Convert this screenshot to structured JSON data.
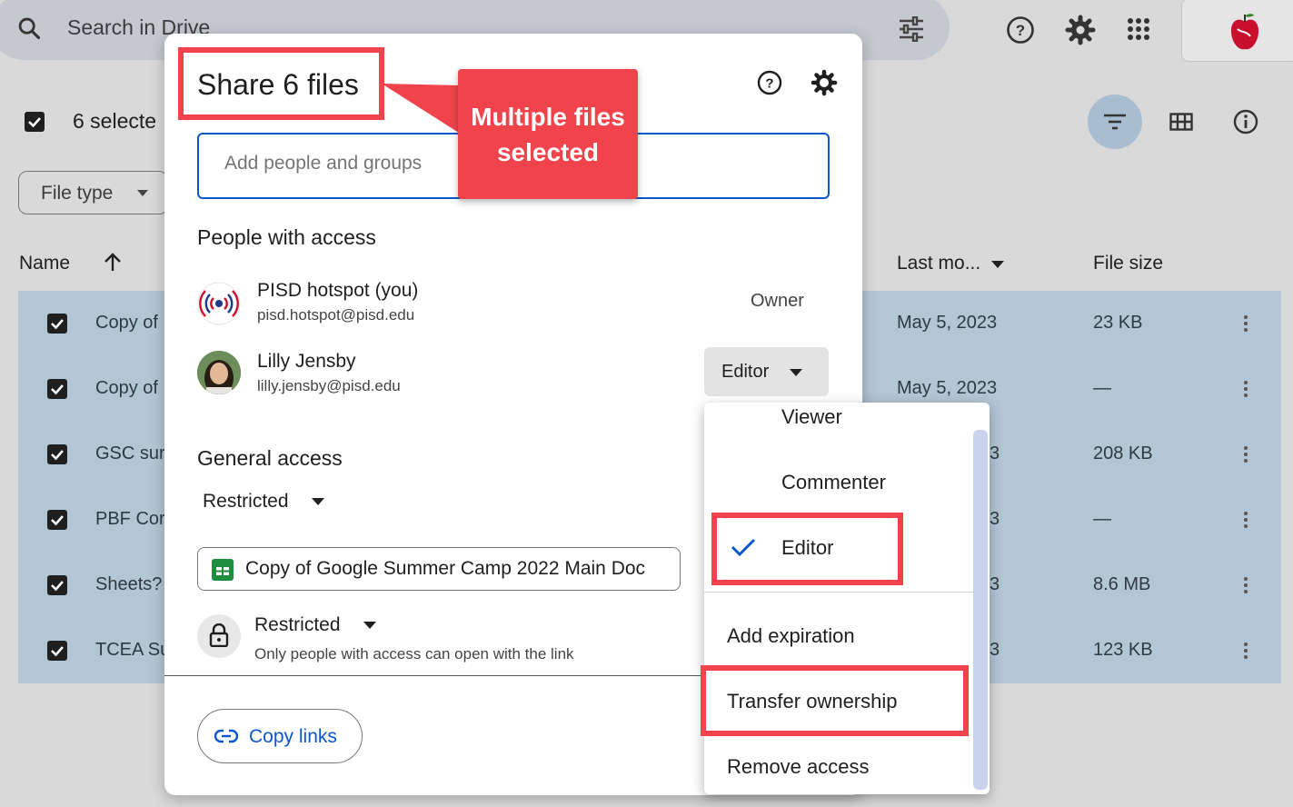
{
  "drive": {
    "search_placeholder": "Search in Drive",
    "selection_text": "6 selecte",
    "filter_chip": "File type",
    "columns": {
      "name": "Name",
      "last_modified": "Last mo...",
      "file_size": "File size"
    },
    "rows": [
      {
        "name": "Copy of",
        "date": "May 5, 2023",
        "size": "23 KB"
      },
      {
        "name": "Copy of",
        "date": "May 5, 2023",
        "size": "—"
      },
      {
        "name": "GSC sur",
        "date": "3",
        "size": "208 KB"
      },
      {
        "name": "PBF Cor",
        "date": "3",
        "size": "—"
      },
      {
        "name": "Sheets?",
        "date": "3",
        "size": "8.6 MB"
      },
      {
        "name": "TCEA Su",
        "date": "3",
        "size": "123 KB"
      }
    ]
  },
  "dialog": {
    "title": "Share 6 files",
    "add_placeholder": "Add people and groups",
    "people_heading": "People with access",
    "people": [
      {
        "name": "PISD hotspot (you)",
        "email": "pisd.hotspot@pisd.edu",
        "role": "Owner"
      },
      {
        "name": "Lilly Jensby",
        "email": "lilly.jensby@pisd.edu",
        "role": "Editor"
      }
    ],
    "general_heading": "General access",
    "general_access_value": "Restricted",
    "file_chip": "Copy of Google Summer Camp 2022 Main Doc",
    "link_access": "Restricted",
    "link_access_desc": "Only people with access can open with the link",
    "copy_links": "Copy links"
  },
  "callout": {
    "line1": "Multiple files",
    "line2": "selected"
  },
  "role_menu": {
    "viewer": "Viewer",
    "commenter": "Commenter",
    "editor": "Editor",
    "add_expiration": "Add expiration",
    "transfer_ownership": "Transfer ownership",
    "remove_access": "Remove access"
  },
  "colors": {
    "highlight": "#f0434b",
    "accent": "#0b57d0",
    "selection": "#b3c6d4"
  },
  "icons": [
    "search-icon",
    "tune-icon",
    "help-icon",
    "settings-icon",
    "apps-icon",
    "filter-icon",
    "grid-icon",
    "info-icon",
    "sort-up-icon",
    "dropdown-icon",
    "lock-icon",
    "link-icon",
    "sheets-icon",
    "check-icon"
  ]
}
